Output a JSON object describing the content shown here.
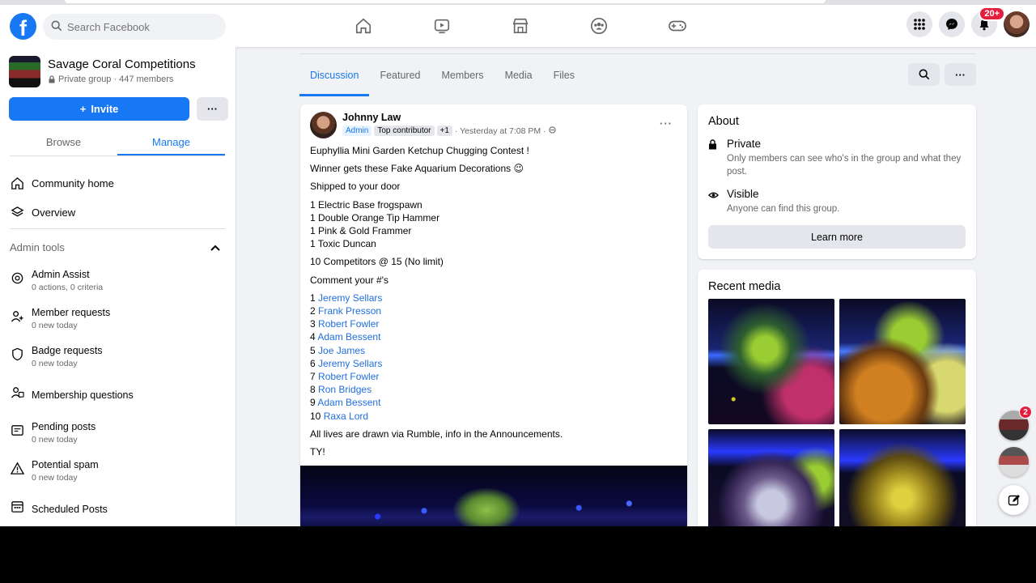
{
  "topbar": {
    "logo": "f",
    "search_placeholder": "Search Facebook",
    "notifications_badge": "20+"
  },
  "group": {
    "name": "Savage Coral Competitions",
    "privacy": "Private group",
    "members": "447 members",
    "invite_label": "Invite",
    "more_label": "···"
  },
  "sidebar": {
    "tabs": [
      "Browse",
      "Manage"
    ],
    "menu": [
      "Community home",
      "Overview"
    ],
    "admin_tools_title": "Admin tools",
    "admin_items": [
      {
        "label": "Admin Assist",
        "sub": "0 actions, 0 criteria"
      },
      {
        "label": "Member requests",
        "sub": "0 new today"
      },
      {
        "label": "Badge requests",
        "sub": "0 new today"
      },
      {
        "label": "Membership questions",
        "sub": ""
      },
      {
        "label": "Pending posts",
        "sub": "0 new today"
      },
      {
        "label": "Potential spam",
        "sub": "0 new today"
      },
      {
        "label": "Scheduled Posts",
        "sub": ""
      }
    ]
  },
  "main_tabs": [
    "Discussion",
    "Featured",
    "Members",
    "Media",
    "Files"
  ],
  "post": {
    "author": "Johnny Law",
    "badges": [
      "Admin",
      "Top contributor",
      "+1"
    ],
    "time": "· Yesterday at 7:08 PM ·",
    "dots": "···",
    "lines": [
      "Euphyllia Mini Garden Ketchup Chugging Contest !",
      "Winner gets these Fake Aquarium Decorations 😉",
      "Shipped to your door"
    ],
    "items": [
      "1 Electric Base frogspawn",
      "1 Double Orange Tip Hammer",
      "1 Pink & Gold Frammer",
      "1 Toxic Duncan"
    ],
    "competitors": "10 Competitors @ 15 (No limit)",
    "comment_prompt": "Comment your #'s",
    "entries": [
      {
        "num": "1",
        "name": "Jeremy Sellars"
      },
      {
        "num": "2",
        "name": "Frank Presson"
      },
      {
        "num": "3",
        "name": "Robert Fowler"
      },
      {
        "num": "4",
        "name": "Adam Bessent"
      },
      {
        "num": "5",
        "name": "Joe James"
      },
      {
        "num": "6",
        "name": "Jeremy Sellars"
      },
      {
        "num": "7",
        "name": "Robert Fowler"
      },
      {
        "num": "8",
        "name": "Ron Bridges"
      },
      {
        "num": "9",
        "name": "Adam Bessent"
      },
      {
        "num": "10",
        "name": "Raxa Lord"
      }
    ],
    "footer": "All lives are drawn via Rumble, info in the Announcements.",
    "signoff": "TY!"
  },
  "about": {
    "title": "About",
    "private_title": "Private",
    "private_desc": "Only members can see who's in the group and what they post.",
    "visible_title": "Visible",
    "visible_desc": "Anyone can find this group.",
    "learn_more": "Learn more"
  },
  "recent_media": {
    "title": "Recent media"
  },
  "chat": {
    "badge": "2"
  },
  "colors": {
    "brand": "#1877f2",
    "link": "#216fdb",
    "badge_red": "#e41e3f"
  }
}
